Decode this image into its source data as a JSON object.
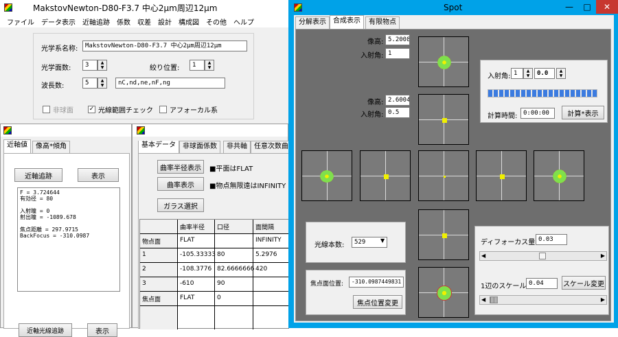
{
  "main": {
    "title": "MakstovNewton-D80-F3.7  中心2μm周辺12μm",
    "menu": [
      "ファイル",
      "データ表示",
      "近軸追跡",
      "係数",
      "収差",
      "設計",
      "構成図",
      "その他",
      "ヘルプ"
    ],
    "name_label": "光学系名称:",
    "name_value": "MakstovNewton-D80-F3.7  中心2μm周辺12μm",
    "surfaces_label": "光学面数:",
    "surfaces_value": "3",
    "stop_label": "絞り位置:",
    "stop_value": "1",
    "wave_label": "波長数:",
    "wave_value": "5",
    "wave_list": "nC,nd,ne,nF,ng",
    "chk_aspheric": "非球面",
    "chk_raycheck": "光線範囲チェック",
    "chk_afocal": "アフォーカル系"
  },
  "paraxial": {
    "tabs": [
      "近軸値",
      "像高*傾角"
    ],
    "trace_button": "近軸追跡",
    "show_button": "表示",
    "results": [
      "F = 3.724644",
      "有効径 = 80",
      "",
      "入射瞳 = 0",
      "射出瞳 = -1089.678",
      "",
      "焦点距離  = 297.9715",
      "BackFocus = -310.0987"
    ],
    "bottom_left_button": "近軸光線追跡",
    "bottom_right_button": "表示"
  },
  "data": {
    "tabs": [
      "基本データ",
      "非球面係数",
      "非共軸",
      "任意次数曲面"
    ],
    "curvature_radius_button": "曲率半径表示",
    "curvature_button": "曲率表示",
    "flat_note": "■平面はFLAT",
    "infinity_note": "■物点無限遠はINFINITY",
    "glass_button": "ガラス選択",
    "columns": [
      "",
      "曲率半径",
      "口径",
      "面間隔"
    ],
    "rows": [
      [
        "物点面",
        "FLAT",
        "",
        "INFINITY"
      ],
      [
        "1",
        "-105.33333",
        "80",
        "5.2976"
      ],
      [
        "2",
        "-108.3776",
        "82.6666666",
        "420"
      ],
      [
        "3",
        "-610",
        "90",
        ""
      ],
      [
        "焦点面",
        "FLAT",
        "0",
        ""
      ]
    ]
  },
  "spot": {
    "title": "Spot",
    "tabs": [
      "分解表示",
      "合成表示",
      "有限物点"
    ],
    "img_height_label": "像高:",
    "incidence_label": "入射角:",
    "top_height": "5.2008",
    "top_angle": "1",
    "mid_height": "2.6004",
    "mid_angle": "0.5",
    "angle_panel_label": "入射角:",
    "angle_panel_v1": "1",
    "angle_panel_v2": "0.0",
    "progress": 1.0,
    "calc_time_label": "計算時間:",
    "calc_time_value": "0:00:00",
    "calc_button": "計算*表示",
    "rays_label": "光線本数:",
    "rays_value": "529",
    "focus_label": "焦点面位置:",
    "focus_value": "-310.0987449831",
    "focus_button": "焦点位置変更",
    "defocus_label": "ディフォーカス量:",
    "defocus_value": "0.03",
    "scale_label": "1辺のスケール:",
    "scale_value": "0.04",
    "scale_button": "スケール変更",
    "colors": {
      "bg": "#6e6e6e",
      "frame": "#00a2e8",
      "blob_green": "#7fe04c",
      "blob_yellow": "#f0f000",
      "blob_red": "#d03030"
    }
  }
}
